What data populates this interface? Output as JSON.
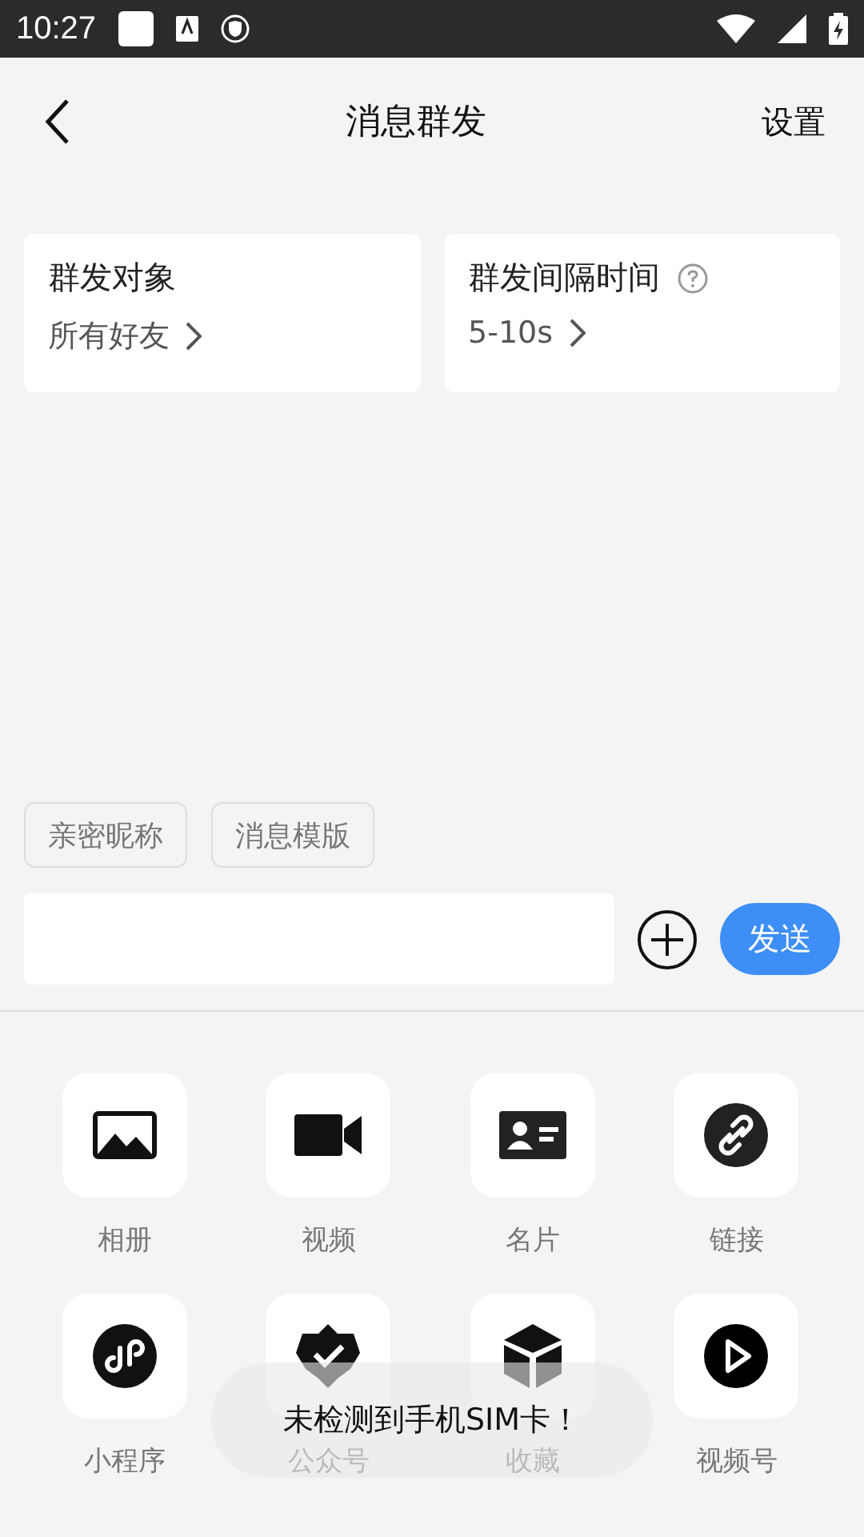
{
  "status_bar": {
    "time": "10:27"
  },
  "header": {
    "title": "消息群发",
    "action": "设置"
  },
  "cards": [
    {
      "title": "群发对象",
      "value": "所有好友",
      "help": false
    },
    {
      "title": "群发间隔时间",
      "value": "5-10s",
      "help": true
    }
  ],
  "chips": [
    "亲密昵称",
    "消息模版"
  ],
  "composer": {
    "send": "发送"
  },
  "tools": [
    {
      "kind": "album",
      "label": "相册"
    },
    {
      "kind": "video",
      "label": "视频"
    },
    {
      "kind": "card",
      "label": "名片"
    },
    {
      "kind": "link",
      "label": "链接"
    },
    {
      "kind": "miniprogram",
      "label": "小程序"
    },
    {
      "kind": "official",
      "label": "公众号"
    },
    {
      "kind": "favorite",
      "label": "收藏"
    },
    {
      "kind": "channels",
      "label": "视频号"
    }
  ],
  "toast": "未检测到手机SIM卡！"
}
